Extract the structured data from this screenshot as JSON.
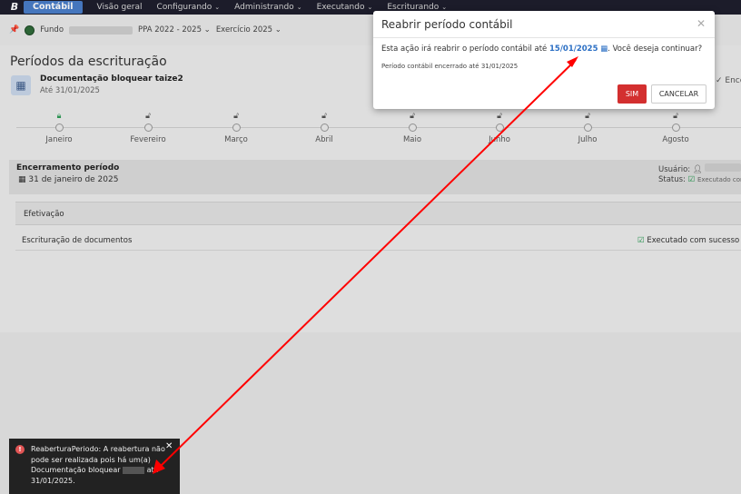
{
  "topbar": {
    "brand_letter": "B",
    "app_name": "Contábil",
    "menu": [
      "Visão geral",
      "Configurando",
      "Administrando",
      "Executando",
      "Escriturando"
    ]
  },
  "subbar": {
    "fund_label": "Fundo",
    "ppa": "PPA 2022 - 2025",
    "exercise": "Exercício 2025"
  },
  "page": {
    "title": "Períodos da escrituração",
    "document": {
      "name": "Documentação bloquear taize2",
      "until": "Até 31/01/2025"
    },
    "right_cut_label": "Encerrad",
    "months": [
      {
        "label": "Janeiro",
        "locked": true
      },
      {
        "label": "Fevereiro",
        "locked": false
      },
      {
        "label": "Março",
        "locked": false
      },
      {
        "label": "Abril",
        "locked": false
      },
      {
        "label": "Maio",
        "locked": false
      },
      {
        "label": "Junho",
        "locked": false
      },
      {
        "label": "Julho",
        "locked": false
      },
      {
        "label": "Agosto",
        "locked": false
      }
    ],
    "closing": {
      "title": "Encerramento período",
      "date": "31 de janeiro de 2025",
      "user_label": "Usuário:",
      "status_label": "Status:",
      "status_value": "Executado com"
    },
    "efetivacao_label": "Efetivação",
    "row": {
      "label": "Escrituração de documentos",
      "result": "Executado com sucesso"
    }
  },
  "modal": {
    "title": "Reabrir período contábil",
    "message_before": "Esta ação irá reabrir o período contábil até",
    "date": "15/01/2025",
    "message_after": ". Você deseja continuar?",
    "sub": "Período contábil encerrado até 31/01/2025",
    "confirm": "SIM",
    "cancel": "CANCELAR"
  },
  "toast": {
    "text_main": "ReaberturaPeriodo: A reabertura não pode ser realizada pois há um(a) Documentação bloquear",
    "text_end": "até 31/01/2025."
  },
  "colors": {
    "accent_red": "#d32f2f",
    "link_blue": "#2b6fc4",
    "success_green": "#2e9c57",
    "annotation_red": "#ff0000"
  }
}
